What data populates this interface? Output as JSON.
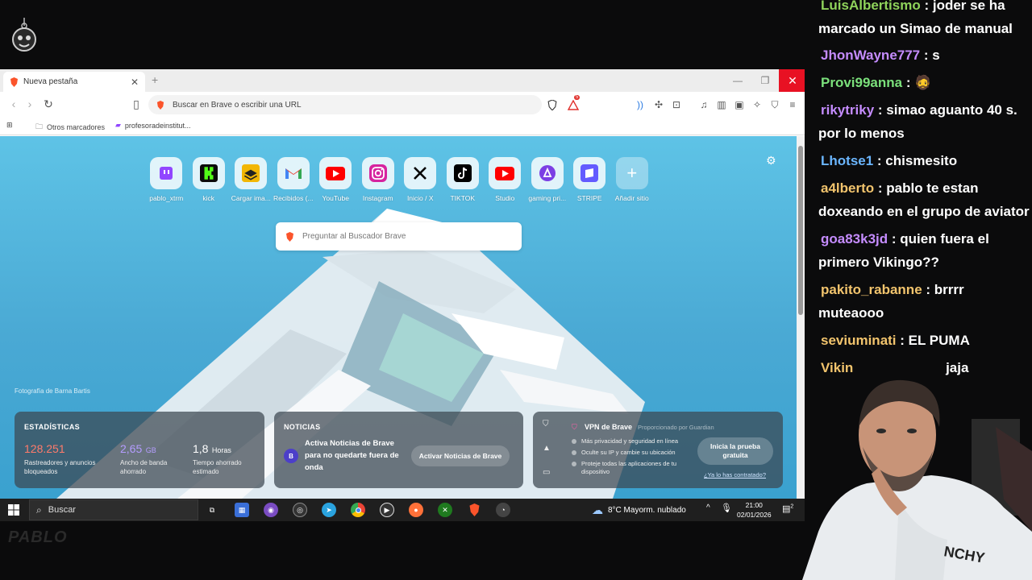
{
  "browser": {
    "tab_title": "Nueva pestaña",
    "url_placeholder": "Buscar en Brave o escribir una URL",
    "rewards_badge": "5",
    "bookmarks": [
      {
        "label": "Otros marcadores"
      },
      {
        "label": "profesoradeinstitut..."
      }
    ]
  },
  "ntp": {
    "top_sites": [
      {
        "label": "pablo_xtrm",
        "icon": "twitch-icon",
        "color": "#9146ff"
      },
      {
        "label": "kick",
        "icon": "kick-icon",
        "color": "#53fc18"
      },
      {
        "label": "Cargar ima...",
        "icon": "layers-icon",
        "color": "#f2b705"
      },
      {
        "label": "Recibidos (...",
        "icon": "gmail-icon",
        "color": "#ea4335"
      },
      {
        "label": "YouTube",
        "icon": "youtube-icon",
        "color": "#ff0000"
      },
      {
        "label": "Instagram",
        "icon": "instagram-icon",
        "color": "#e1306c"
      },
      {
        "label": "Inicio / X",
        "icon": "x-icon",
        "color": "#000000"
      },
      {
        "label": "TIKTOK",
        "icon": "tiktok-icon",
        "color": "#000000"
      },
      {
        "label": "Studio",
        "icon": "youtube-studio-icon",
        "color": "#ff0000"
      },
      {
        "label": "gaming pri...",
        "icon": "aria-icon",
        "color": "#7b3fe4"
      },
      {
        "label": "STRIPE",
        "icon": "stripe-icon",
        "color": "#635bff"
      },
      {
        "label": "Añadir sitio",
        "icon": "plus-icon",
        "color": "#ffffff"
      }
    ],
    "search_placeholder": "Preguntar al Buscador Brave",
    "photo_credit": "Fotografía de Barna Bartis",
    "stats": {
      "heading": "ESTADÍSTICAS",
      "items": [
        {
          "value": "128.251",
          "unit": "",
          "desc": "Rastreadores y anuncios bloqueados",
          "color": "#ff7b6b"
        },
        {
          "value": "2,65",
          "unit": "GB",
          "desc": "Ancho de banda ahorrado",
          "color": "#b49cff"
        },
        {
          "value": "1,8",
          "unit": "Horas",
          "desc": "Tiempo ahorrado estimado",
          "color": "#ffffff"
        }
      ]
    },
    "news": {
      "heading": "NOTICIAS",
      "text": "Activa Noticias de Brave para no quedarte fuera de onda",
      "button": "Activar Noticias de Brave",
      "logo": "B"
    },
    "vpn": {
      "title": "VPN de Brave",
      "provider": "Proporcionado por  Guardian",
      "features": [
        "Más privacidad y seguridad en línea",
        "Oculte su IP y cambie su ubicación",
        "Proteje todas las aplicaciones de tu dispositivo"
      ],
      "button": "Inicia la prueba gratuita",
      "link": "¿Ya lo has contratado?"
    }
  },
  "taskbar": {
    "search_label": "Buscar",
    "weather": "8°C  Mayorm. nublado",
    "time": "21:00",
    "date": "02/01/2026",
    "notif_count": "2"
  },
  "chat": [
    {
      "user": "LuisAlbertismo",
      "color": "#8fd35b",
      "text": "joder se ha marcado un Simao de manual"
    },
    {
      "user": "JhonWayne777",
      "color": "#c58cff",
      "text": "s"
    },
    {
      "user": "Provi99anna",
      "color": "#7be07b",
      "text": "🧔"
    },
    {
      "user": "rikytriky",
      "color": "#c58cff",
      "text": "simao aguanto 40 s. por lo menos"
    },
    {
      "user": "Lhotse1",
      "color": "#6bb6ff",
      "text": "chismesito"
    },
    {
      "user": "a4lberto",
      "color": "#f2c46d",
      "text": "pablo te estan doxeando en el grupo de aviator"
    },
    {
      "user": "goa83k3jd",
      "color": "#c58cff",
      "text": "quien fuera el primero Vikingo??"
    },
    {
      "user": "pakito_rabanne",
      "color": "#f2c46d",
      "text": "brrrr muteaooo"
    },
    {
      "user": "seviuminati",
      "color": "#f2c46d",
      "text": "EL PUMA"
    },
    {
      "user": "Vikin",
      "color": "#f2c46d",
      "text": "jaja"
    }
  ],
  "overlay": {
    "bottom_logo": "PABLO"
  }
}
